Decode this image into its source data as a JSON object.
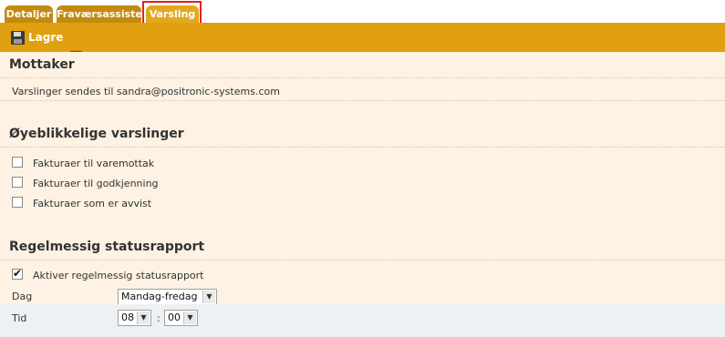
{
  "tabs": [
    {
      "label": "Detaljer"
    },
    {
      "label": "Fraværsassistent"
    },
    {
      "label": "Varsling"
    }
  ],
  "toolbar": {
    "save_label": "Lagre"
  },
  "sections": {
    "recipient": {
      "title": "Mottaker",
      "text": "Varslinger sendes til sandra@positronic-systems.com"
    },
    "immediate": {
      "title": "Øyeblikkelige varslinger",
      "options": [
        {
          "label": "Fakturaer til varemottak",
          "checked": false
        },
        {
          "label": "Fakturaer til godkjenning",
          "checked": false
        },
        {
          "label": "Fakturaer som er avvist",
          "checked": false
        }
      ]
    },
    "report": {
      "title": "Regelmessig statusrapport",
      "enable": {
        "label": "Aktiver regelmessig statusrapport",
        "checked": true
      },
      "day_label": "Dag",
      "day_value": "Mandag-fredag",
      "time_label": "Tid",
      "hour_value": "08",
      "colon": ":",
      "minute_value": "00"
    }
  },
  "colors": {
    "accent": "#e0a00f",
    "highlight": "#e8201c",
    "background": "#fdf2e3"
  },
  "icons": {
    "save": "floppy-disk-icon",
    "pointer": "red-arrow-icon"
  }
}
